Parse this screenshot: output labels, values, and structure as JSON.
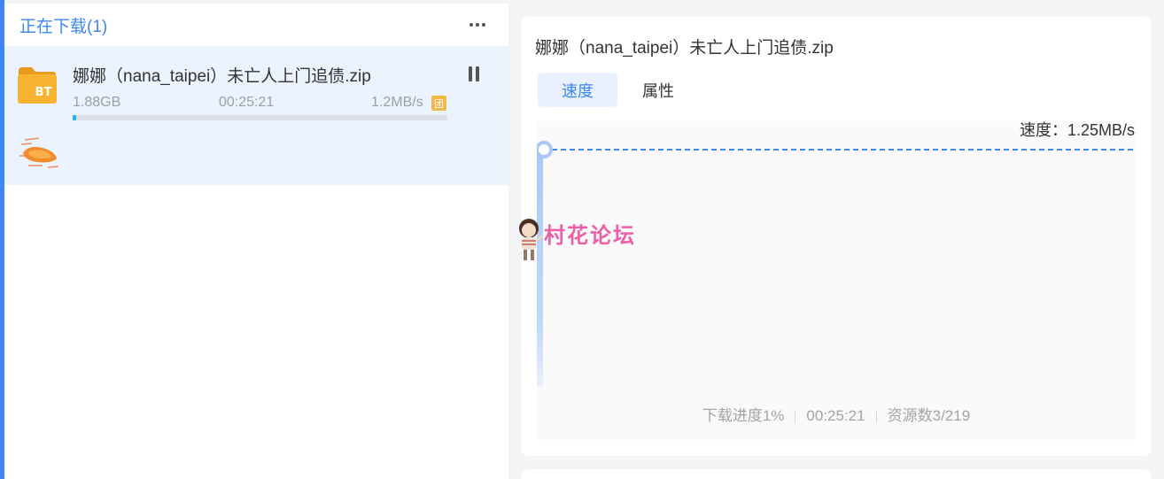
{
  "downloads": {
    "header_title": "正在下载(1)",
    "more_icon": "more-dots-icon",
    "task": {
      "name": "娜娜（nana_taipei）未亡人上门追债.zip",
      "file_icon": "bt-folder-icon",
      "file_icon_label": "BT",
      "size": "1.88GB",
      "time_remaining": "00:25:21",
      "speed": "1.2MB/s",
      "speed_badge": "团",
      "progress_percent": 1,
      "pause_icon": "pause-icon",
      "turbo_icon": "turbo-boost-icon"
    }
  },
  "detail": {
    "title": "娜娜（nana_taipei）未亡人上门追债.zip",
    "tabs": [
      {
        "label": "速度",
        "active": true
      },
      {
        "label": "属性",
        "active": false
      }
    ],
    "speed_readout": "速度：1.25MB/s",
    "stats": {
      "progress": "下载进度1%",
      "time": "00:25:21",
      "sources": "资源数3/219"
    }
  },
  "watermark": {
    "text": "村花论坛"
  },
  "colors": {
    "accent": "#3b86f0",
    "progress": "#1fb5e6",
    "card_highlight": "#eaf3fe",
    "watermark": "#ee5fa8"
  }
}
